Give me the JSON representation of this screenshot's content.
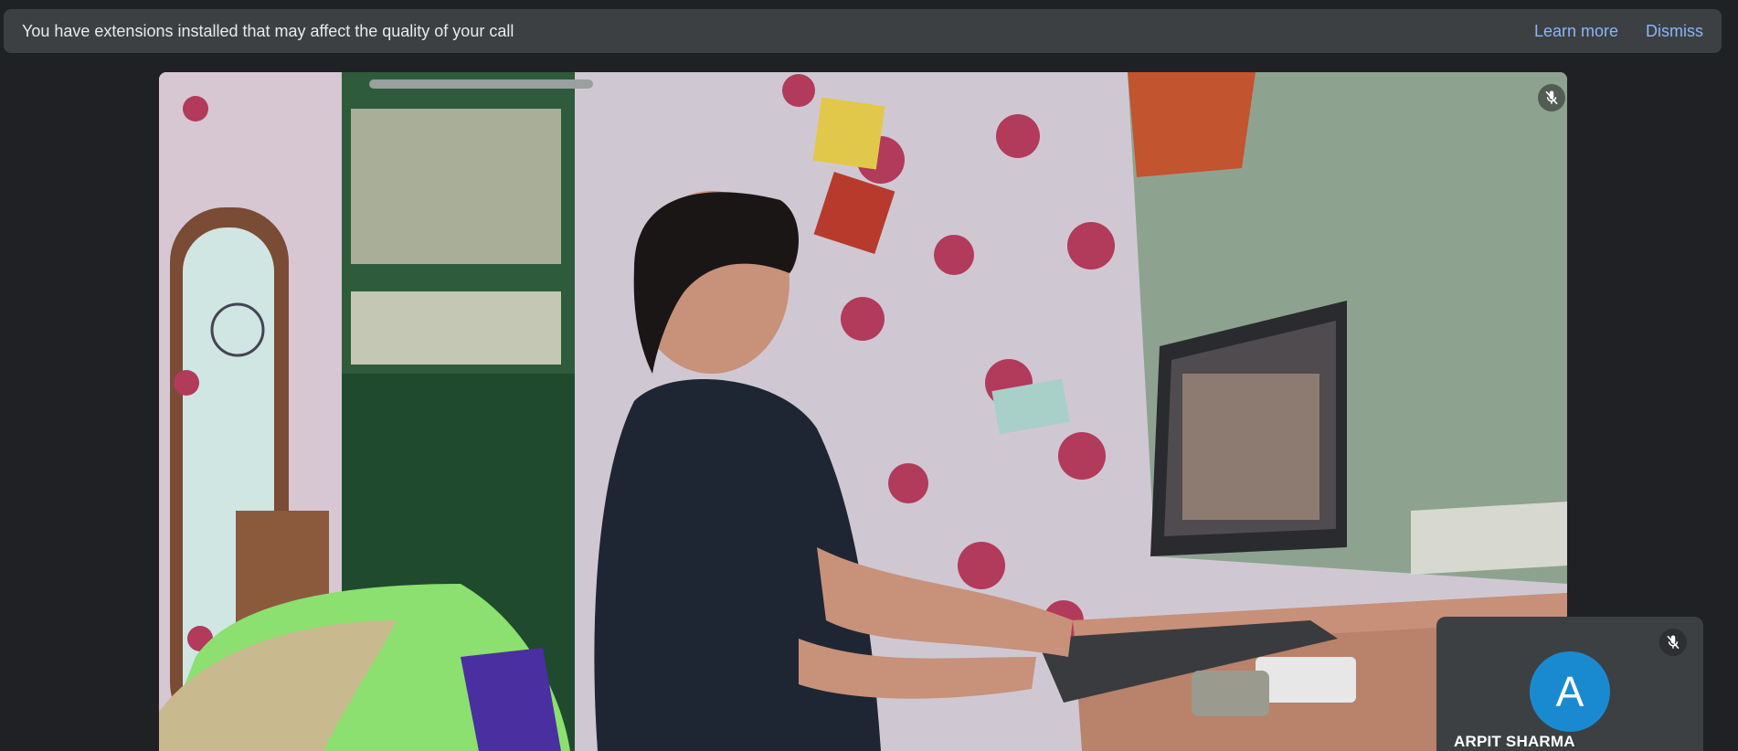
{
  "banner": {
    "message": "You have extensions installed that may affect the quality of your call",
    "learn_more_label": "Learn more",
    "dismiss_label": "Dismiss"
  },
  "main_video": {
    "mic_state": "muted",
    "mic_icon": "mic-off-icon"
  },
  "self_tile": {
    "avatar_initial": "A",
    "avatar_color": "#1a8ad0",
    "participant_name": "ARPIT SHARMA",
    "mic_state": "muted",
    "mic_icon": "mic-off-icon"
  },
  "colors": {
    "background": "#202124",
    "banner_bg": "#3c4043",
    "link": "#8ab4f8",
    "text": "#e8eaed"
  }
}
